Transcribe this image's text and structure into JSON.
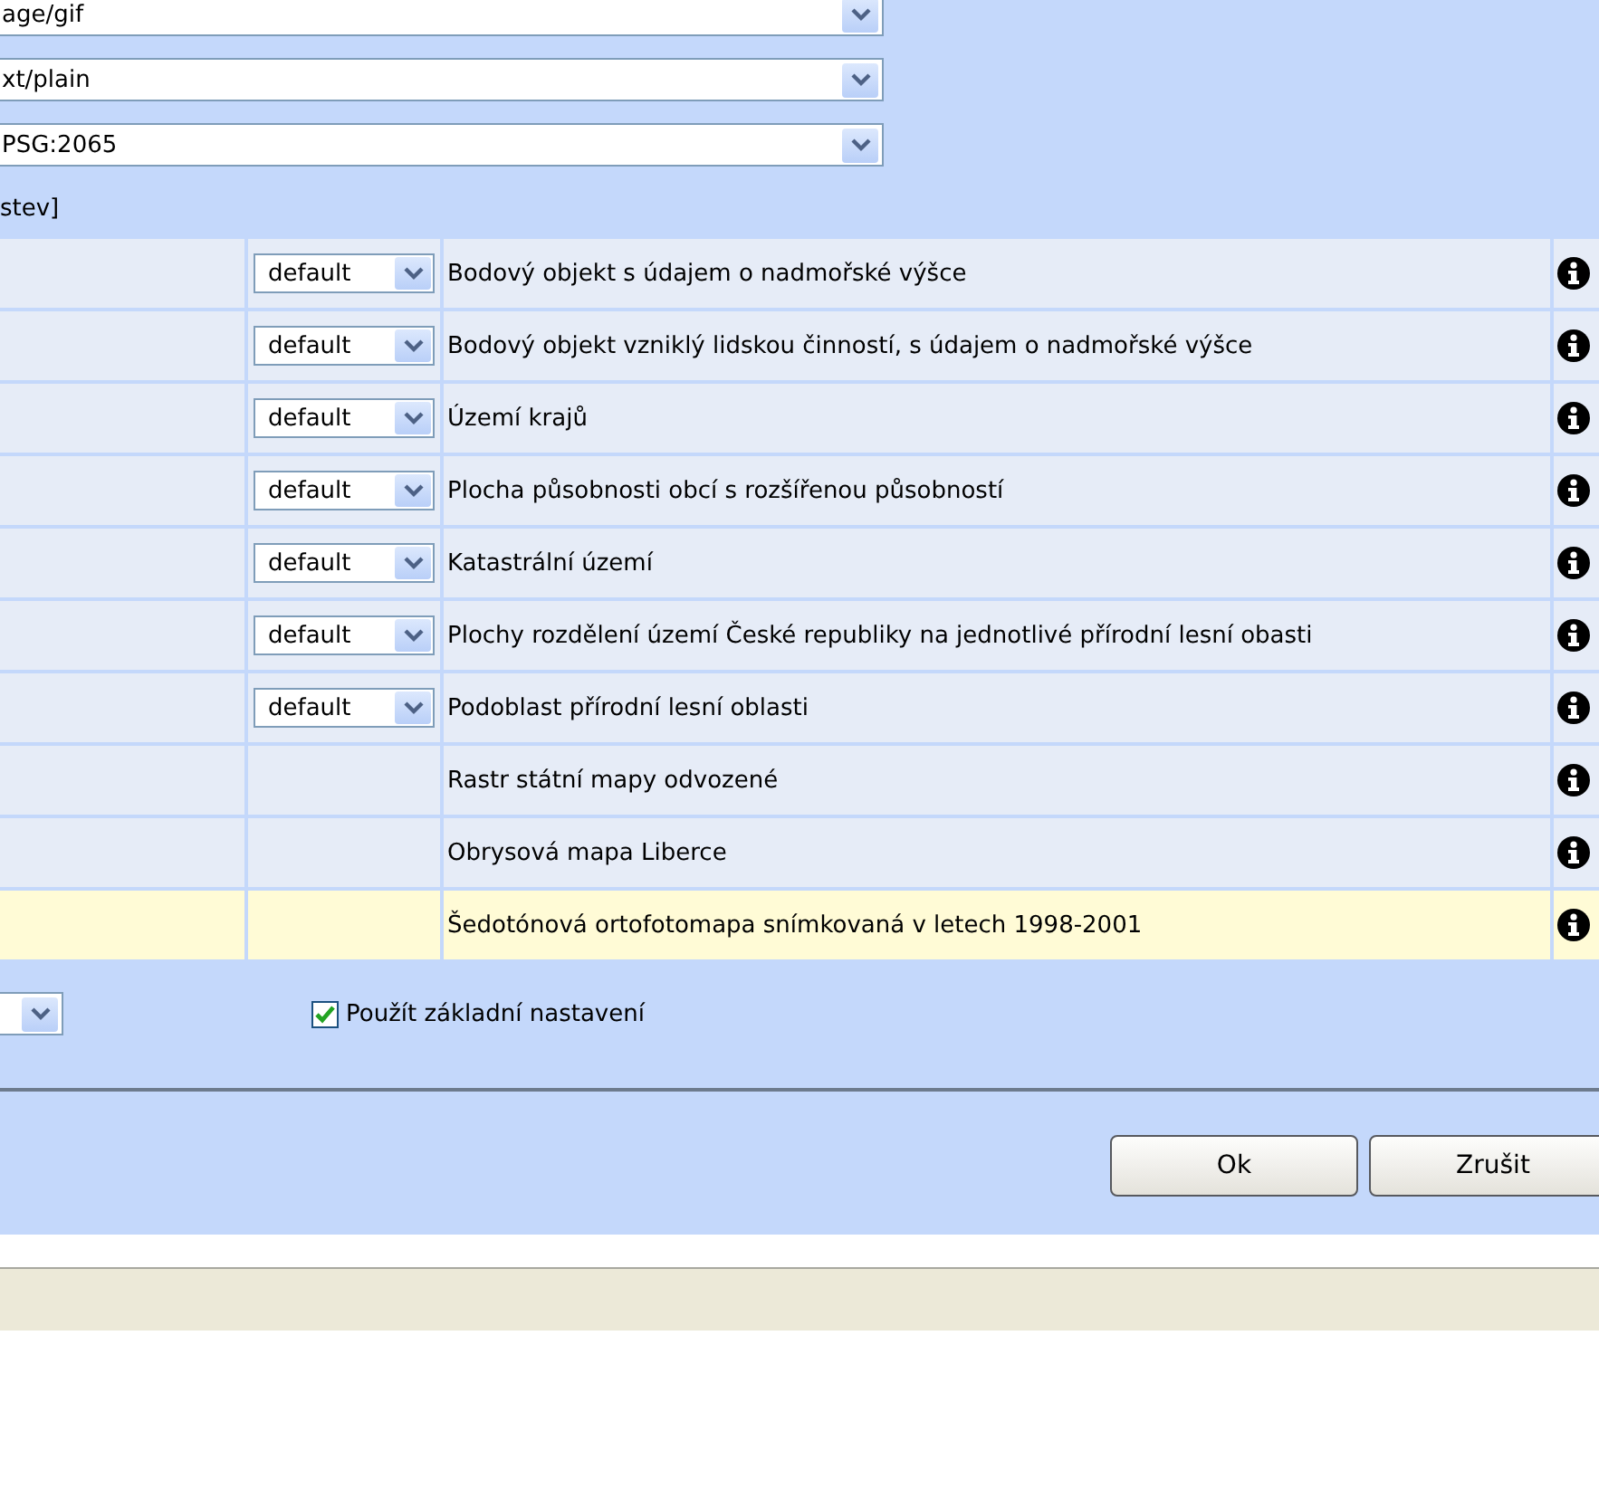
{
  "selects": [
    {
      "value": "age/gif"
    },
    {
      "value": "xt/plain"
    },
    {
      "value": "PSG:2065"
    }
  ],
  "section_label": "stev]",
  "layers": [
    {
      "style": "default",
      "title": "Bodový objekt s údajem o nadmořské výšce",
      "highlighted": false
    },
    {
      "style": "default",
      "title": "Bodový objekt vzniklý lidskou činností, s údajem o nadmořské výšce",
      "highlighted": false
    },
    {
      "style": "default",
      "title": "Území krajů",
      "highlighted": false
    },
    {
      "style": "default",
      "title": "Plocha působnosti obcí s rozšířenou působností",
      "highlighted": false
    },
    {
      "style": "default",
      "title": "Katastrální území",
      "highlighted": false
    },
    {
      "style": "default",
      "title": "Plochy rozdělení území České republiky na jednotlivé přírodní lesní obasti",
      "highlighted": false
    },
    {
      "style": "default",
      "title": "Podoblast přírodní lesní oblasti",
      "highlighted": false
    },
    {
      "title": "Rastr státní mapy odvozené",
      "highlighted": false
    },
    {
      "title": "Obrysová mapa Liberce",
      "highlighted": false
    },
    {
      "title": "Šedotónová ortofotomapa snímkovaná v letech 1998-2001",
      "highlighted": true
    }
  ],
  "default_settings": {
    "label": "Použít základní nastavení",
    "checked": true
  },
  "buttons": [
    "Ok",
    "Zrušit"
  ]
}
